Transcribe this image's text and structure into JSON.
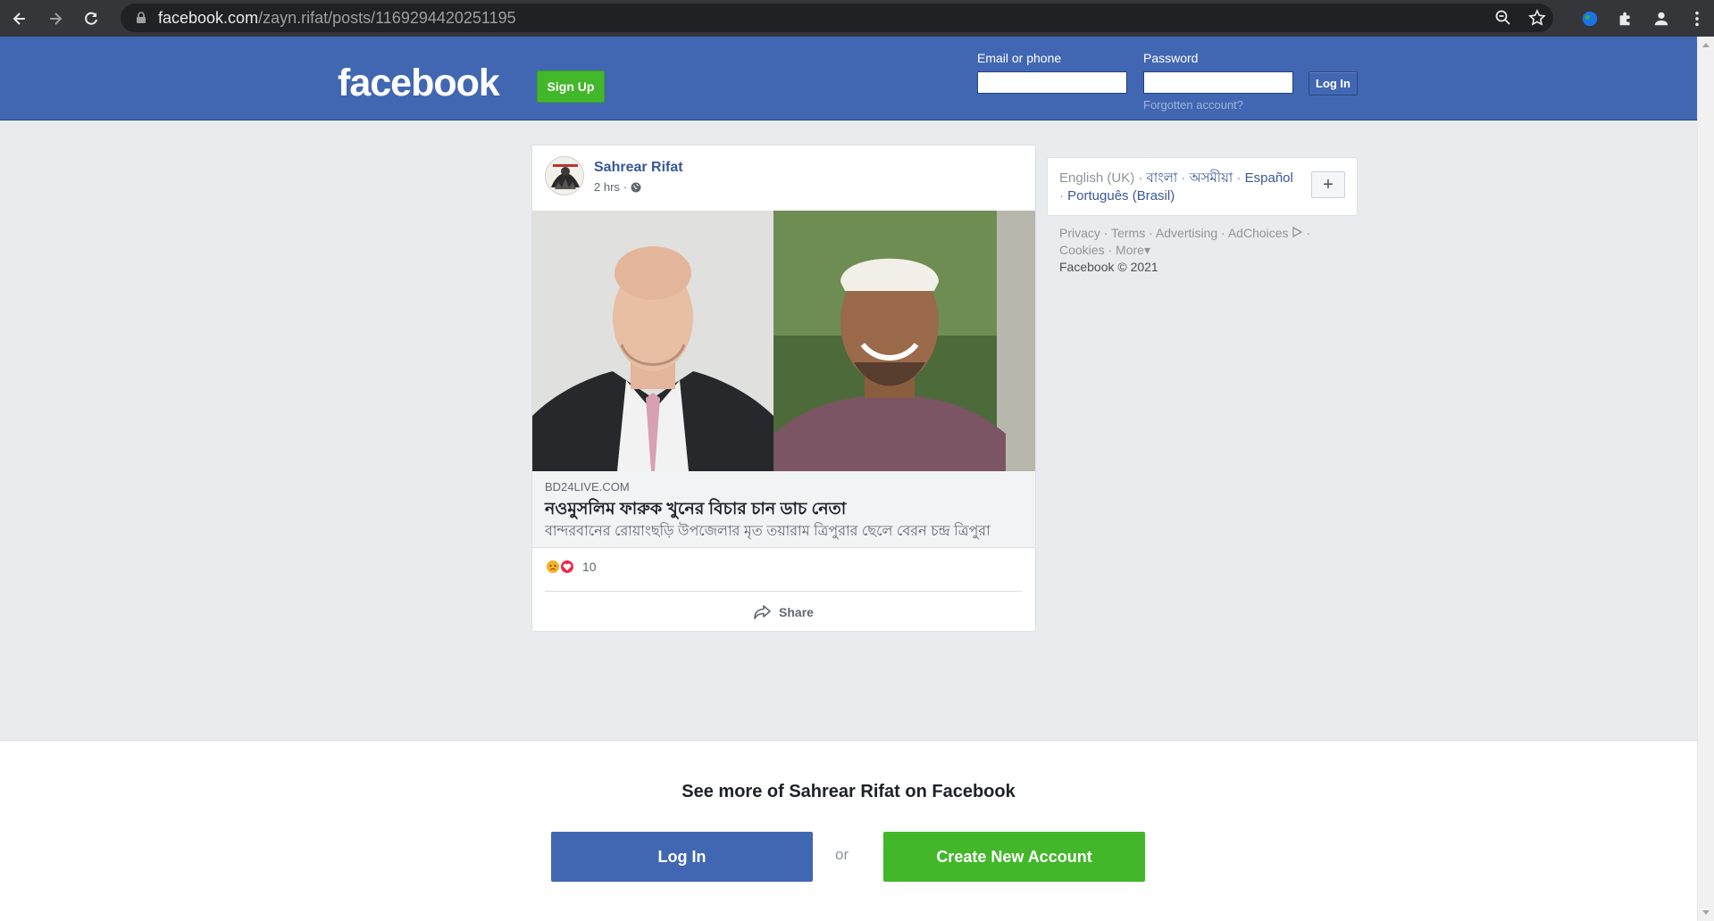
{
  "browser": {
    "url_host": "facebook.com",
    "url_path": "/zayn.rifat/posts/1169294420251195"
  },
  "header": {
    "logo": "facebook",
    "signup_label": "Sign Up",
    "email_label": "Email or phone",
    "password_label": "Password",
    "login_label": "Log In",
    "forgot_label": "Forgotten account?"
  },
  "post": {
    "author": "Sahrear Rifat",
    "time": "2 hrs",
    "link": {
      "domain": "BD24LIVE.COM",
      "title": "নওমুসলিম ফারুক খুনের বিচার চান ডাচ নেতা",
      "description": "বান্দরবানের রোয়াংছড়ি উপজেলার মৃত তয়ারাম ত্রিপুরার ছেলে বেরন চন্দ্র ত্রিপুরা"
    },
    "reaction_count": "10",
    "share_label": "Share"
  },
  "languages": {
    "current": "English (UK)",
    "others": [
      "বাংলা",
      "অসমীয়া",
      "Español",
      "Português (Brasil)"
    ]
  },
  "footer": {
    "links": [
      "Privacy",
      "Terms",
      "Advertising",
      "AdChoices",
      "Cookies",
      "More"
    ],
    "copyright": "Facebook © 2021"
  },
  "promo": {
    "title": "See more of Sahrear Rifat on Facebook",
    "login_label": "Log In",
    "or_label": "or",
    "create_label": "Create New Account"
  },
  "colors": {
    "fb_blue": "#4267b2",
    "fb_green": "#42b72a",
    "link_blue": "#385898"
  }
}
